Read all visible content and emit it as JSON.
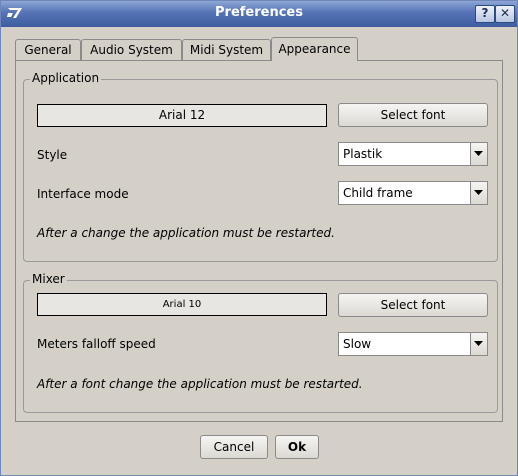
{
  "window": {
    "title": "Preferences"
  },
  "titlebar_buttons": {
    "help": "?",
    "close": "✕"
  },
  "tabs": [
    {
      "label": "General"
    },
    {
      "label": "Audio System"
    },
    {
      "label": "Midi System"
    },
    {
      "label": "Appearance"
    }
  ],
  "application": {
    "title": "Application",
    "font_display": "Arial  12",
    "select_font": "Select font",
    "style_label": "Style",
    "style_value": "Plastik",
    "mode_label": "Interface mode",
    "mode_value": "Child frame",
    "note": "After a change the application must be restarted."
  },
  "mixer": {
    "title": "Mixer",
    "font_display": "Arial  10",
    "select_font": "Select font",
    "meters_label": "Meters falloff speed",
    "meters_value": "Slow",
    "note": "After a font change the application must be restarted."
  },
  "buttons": {
    "cancel": "Cancel",
    "ok": "Ok"
  },
  "colors": {
    "titlebar": "#5674b6",
    "background": "#d4d0c8"
  },
  "icons": {
    "app": "app-logo-icon",
    "help": "help-icon",
    "close": "close-icon",
    "dropdown": "chevron-down-icon"
  }
}
